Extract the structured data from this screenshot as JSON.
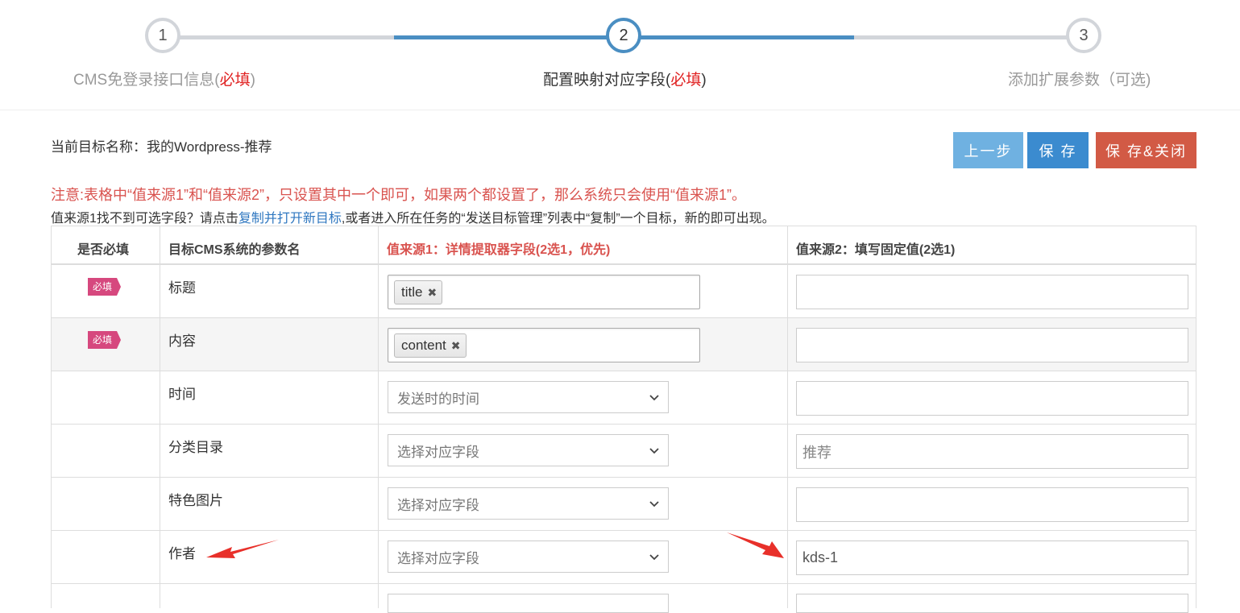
{
  "stepper": {
    "steps": [
      {
        "num": "1",
        "label": "CMS免登录接口信息(",
        "req": "必填",
        "suffix": ")"
      },
      {
        "num": "2",
        "label": "配置映射对应字段(",
        "req": "必填",
        "suffix": ")"
      },
      {
        "num": "3",
        "label": "添加扩展参数（可选)",
        "req": "",
        "suffix": ""
      }
    ],
    "active_step": 2
  },
  "header": {
    "target_name": "当前目标名称：我的Wordpress-推荐",
    "buttons": {
      "prev": "上一步",
      "save": "保 存",
      "save_close": "保 存&关闭"
    }
  },
  "notice": "注意:表格中“值来源1”和“值来源2”，只设置其中一个即可，如果两个都设置了，那么系统只会使用“值来源1”。",
  "hint": {
    "before": "值来源1找不到可选字段？请点击",
    "link": "复制并打开新目标",
    "after": ",或者进入所在任务的“发送目标管理”列表中“复制”一个目标，新的即可出现。"
  },
  "table": {
    "headers": [
      "是否必填",
      "目标CMS系统的参数名",
      "值来源1：详情提取器字段(2选1，优先)",
      "值来源2：填写固定值(2选1)"
    ],
    "required_badge": "必填",
    "rows": [
      {
        "required": true,
        "name": "标题",
        "source1_tag": "title",
        "source2": ""
      },
      {
        "required": true,
        "name": "内容",
        "source1_tag": "content",
        "source2": ""
      },
      {
        "required": false,
        "name": "时间",
        "source1_select": "发送时的时间",
        "source2": ""
      },
      {
        "required": false,
        "name": "分类目录",
        "source1_select": "选择对应字段",
        "source2_placeholder": "推荐"
      },
      {
        "required": false,
        "name": "特色图片",
        "source1_select": "选择对应字段",
        "source2": ""
      },
      {
        "required": false,
        "name": "作者",
        "source1_select": "选择对应字段",
        "source2": "kds-1"
      }
    ]
  },
  "colors": {
    "accent": "#4a8ec2",
    "required_badge": "#d6487e",
    "notice": "#d9534f",
    "annotation_arrow": "#e8302a"
  }
}
